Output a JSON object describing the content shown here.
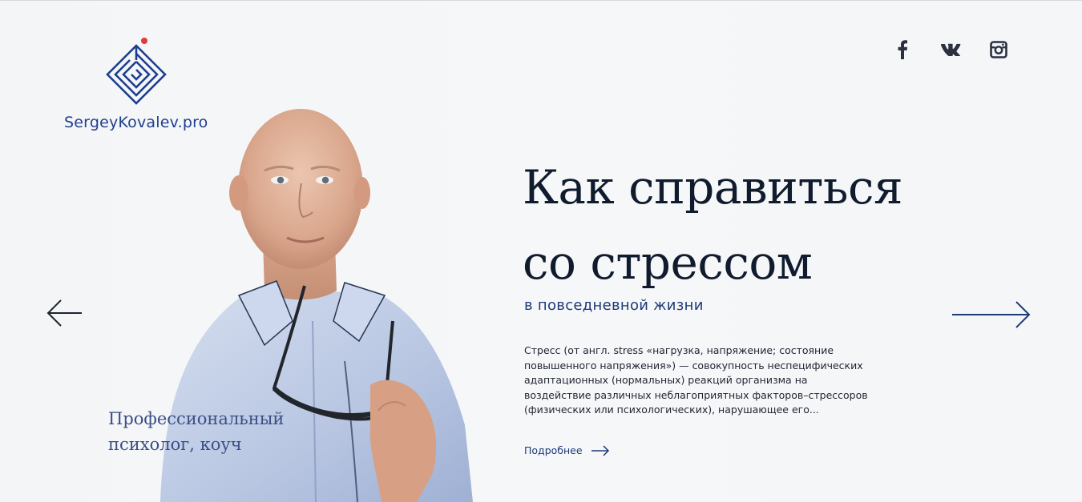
{
  "logo": {
    "text": "SergeyKovalev.pro",
    "icon": "maze-diamond-icon",
    "accent": "#1e3f8f",
    "dot_color": "#e03a3a"
  },
  "socials": [
    {
      "name": "facebook",
      "icon": "facebook-icon",
      "glyph": "f"
    },
    {
      "name": "vk",
      "icon": "vk-icon",
      "glyph": "vk"
    },
    {
      "name": "instagram",
      "icon": "instagram-icon",
      "glyph": ""
    }
  ],
  "hero": {
    "title_line1": "Как справиться",
    "title_line2": "со стрессом",
    "subtitle": "в повседневной жизни",
    "description": "Стресс (от англ. stress «нагрузка, напряжение; состояние повышенного напряжения») — совокупность неспецифических адаптационных (нормальных) реакций организма на воздействие различных неблагоприятных факторов–стрессоров (физических или психологических), нарушающее его...",
    "more_label": "Подробнее",
    "role_line1": "Профессиональный",
    "role_line2": "психолог, коуч"
  },
  "nav": {
    "prev_icon": "arrow-left-icon",
    "next_icon": "arrow-right-icon"
  },
  "colors": {
    "heading": "#101c2e",
    "accent": "#1e3a78",
    "background": "#f4f6f8"
  }
}
